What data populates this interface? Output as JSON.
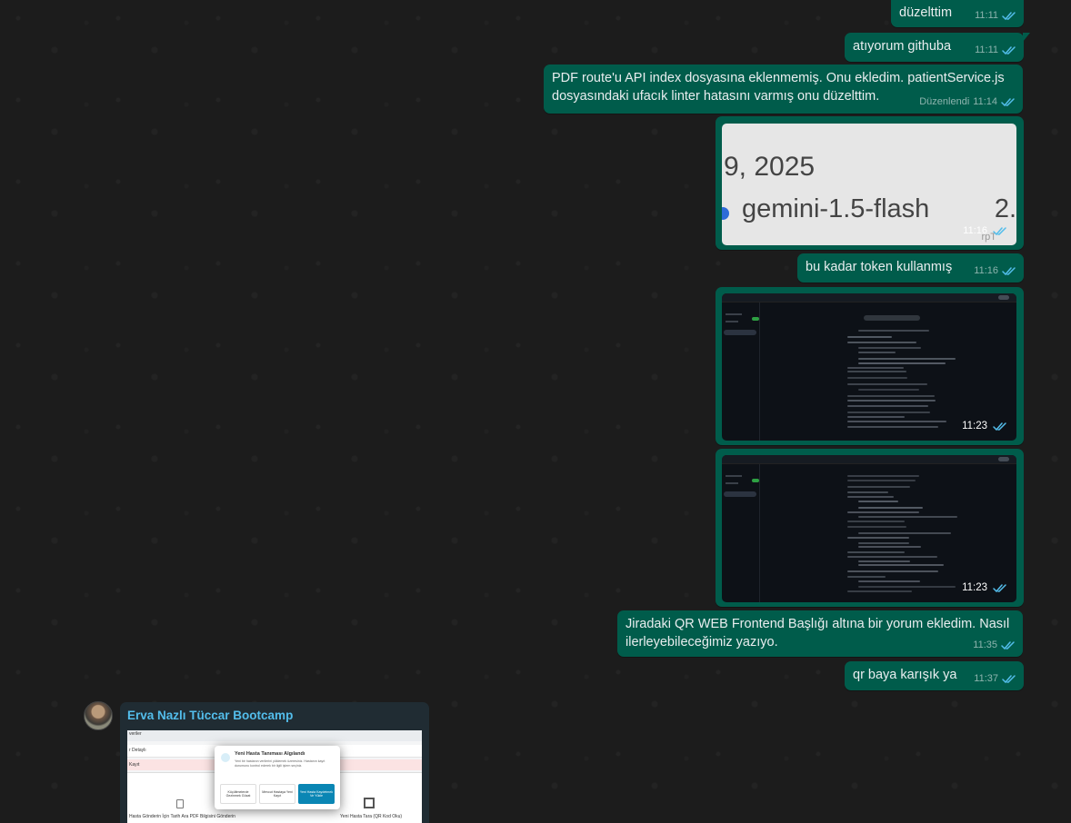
{
  "messages": [
    {
      "text": "düzelttim",
      "time": "11:11",
      "status": "read"
    },
    {
      "text": "atıyorum githuba",
      "time": "11:11",
      "status": "read"
    },
    {
      "text": "PDF route'u API index dosyasına eklenmemiş. Onu ekledim. patientService.js dosyasındaki ufacık linter hatasını varmış onu düzelttim.",
      "edited_label": "Düzenlendi",
      "time": "11:14",
      "status": "read"
    },
    {
      "type": "image",
      "image_text": {
        "line1": "9, 2025",
        "line2": "gemini-1.5-flash",
        "line3": "2.",
        "faint": "rpT"
      },
      "time": "11:16",
      "status": "read"
    },
    {
      "text": "bu kadar token kullanmış",
      "time": "11:16",
      "status": "read"
    },
    {
      "type": "image",
      "time": "11:23",
      "status": "read"
    },
    {
      "type": "image",
      "time": "11:23",
      "status": "read"
    },
    {
      "text": "Jiradaki QR WEB Frontend Başlığı altına bir yorum ekledim. Nasıl ilerleyebileceğimiz yazıyo.",
      "time": "11:35",
      "status": "read"
    },
    {
      "text": "qr baya karışık ya",
      "time": "11:37",
      "status": "read"
    }
  ],
  "incoming": {
    "sender": "Erva Nazlı Tüccar Bootcamp",
    "modal": {
      "title": "Yeni Hasta Tanıması Algılandı",
      "body": "Yeni bir hastanın verilerini yüklemek üzeresiniz. Hastanın kayıt durumunu kontrol ederek bir ilgili işlem seçiniz.",
      "buttons": [
        "Küçültmelerde Gezinmek Gözat",
        "Mevcut Hastaya Yeni Kayıt",
        "Yeni Hasta Kaydetmek Ve Yükle"
      ]
    },
    "side_labels": [
      "veriler",
      "r Detaylı",
      "Kayıt",
      "Hasta Gönderin İçin Tarih Ara PDF Bilgisini Gönderin",
      "Yeni Hasta Tara (QR Kod Oku)"
    ]
  },
  "colors": {
    "outgoing_bubble": "#005c4b",
    "incoming_bubble": "#202c33",
    "read_tick": "#53bdeb",
    "background": "#1c1c1c"
  },
  "icons": [
    "double-check-icon"
  ]
}
